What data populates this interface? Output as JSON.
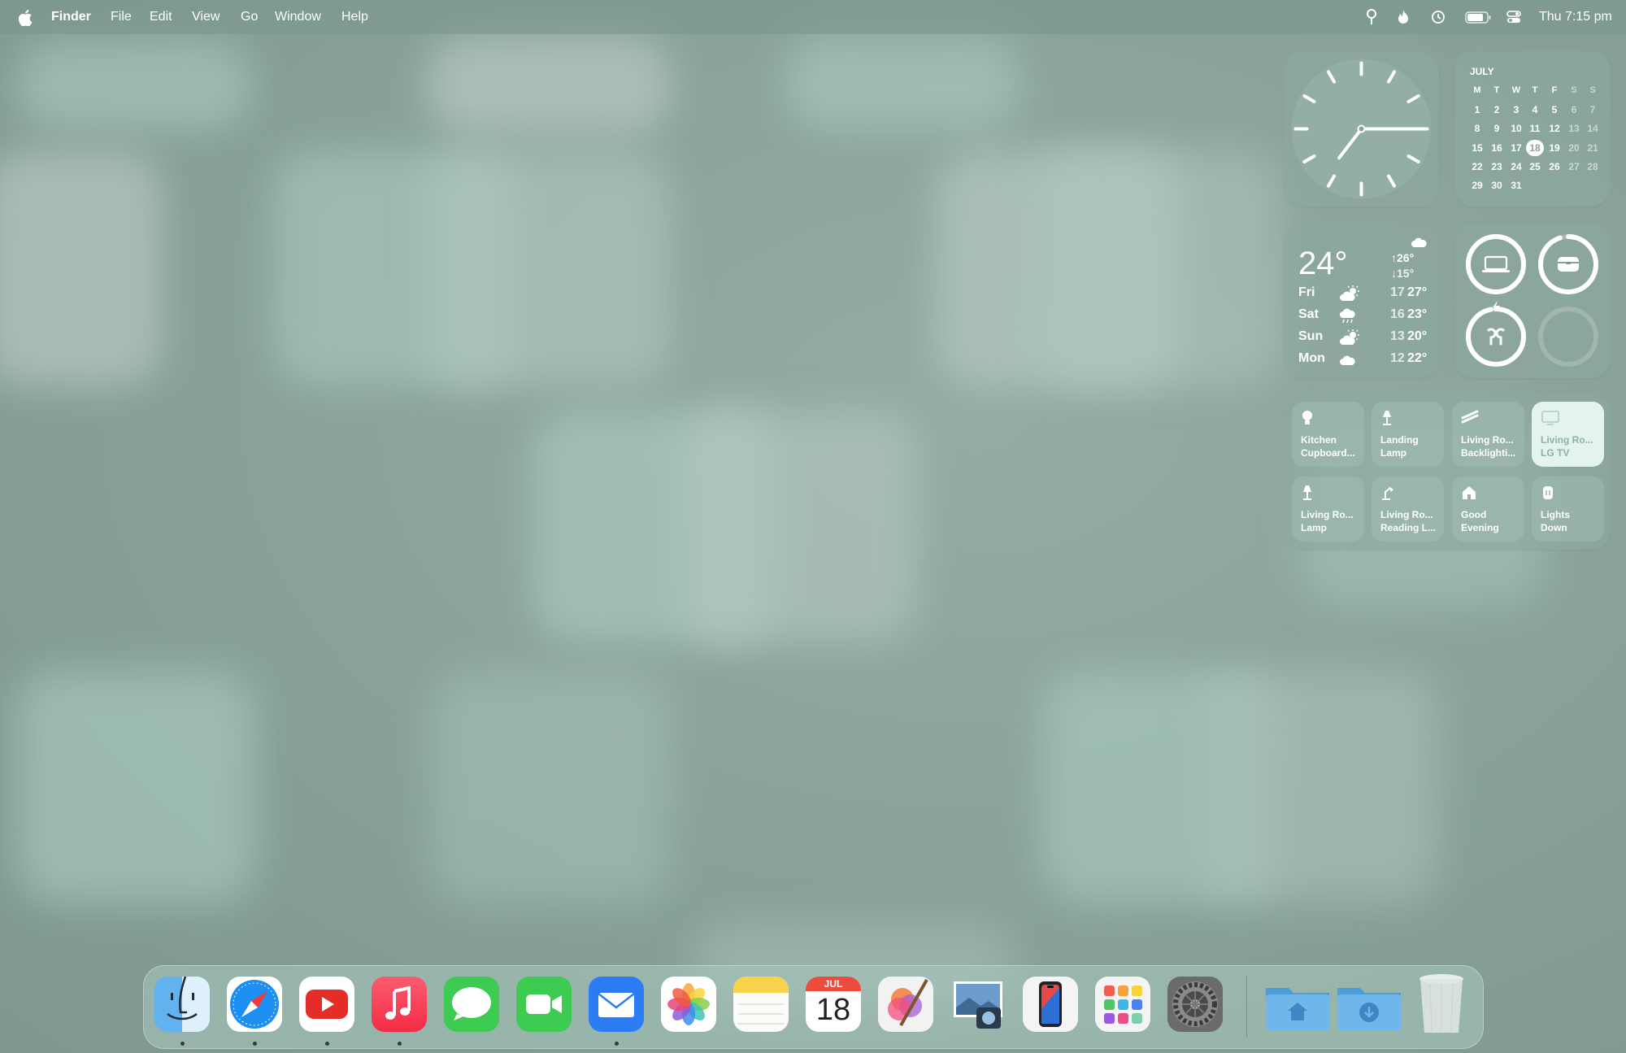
{
  "menubar": {
    "app_name": "Finder",
    "menus": [
      "File",
      "Edit",
      "View",
      "Go",
      "Window",
      "Help"
    ],
    "status_icons": [
      "location-icon",
      "flame-icon",
      "time-machine-icon",
      "battery-icon",
      "control-center-icon"
    ],
    "clock": "Thu 7:15 pm"
  },
  "clock_widget": {
    "time": "7:15",
    "hours": 7,
    "minutes": 15
  },
  "calendar": {
    "month": "JULY",
    "weekdays": [
      "M",
      "T",
      "W",
      "T",
      "F",
      "S",
      "S"
    ],
    "weeks": [
      [
        "1",
        "2",
        "3",
        "4",
        "5",
        "6",
        "7"
      ],
      [
        "8",
        "9",
        "10",
        "11",
        "12",
        "13",
        "14"
      ],
      [
        "15",
        "16",
        "17",
        "18",
        "19",
        "20",
        "21"
      ],
      [
        "22",
        "23",
        "24",
        "25",
        "26",
        "27",
        "28"
      ],
      [
        "29",
        "30",
        "31",
        "",
        "",
        "",
        ""
      ]
    ],
    "today": "18"
  },
  "weather": {
    "current": "24°",
    "high": "26°",
    "low": "15°",
    "current_icon": "cloud-icon",
    "forecast": [
      {
        "day": "Fri",
        "icon": "partly-sunny-icon",
        "low": "17",
        "high": "27°"
      },
      {
        "day": "Sat",
        "icon": "rain-icon",
        "low": "16",
        "high": "23°"
      },
      {
        "day": "Sun",
        "icon": "partly-sunny-icon",
        "low": "13",
        "high": "20°"
      },
      {
        "day": "Mon",
        "icon": "cloud-icon",
        "low": "12",
        "high": "22°"
      }
    ]
  },
  "batteries": [
    {
      "device": "laptop-icon",
      "level": 1.0
    },
    {
      "device": "case-icon",
      "level": 0.95
    },
    {
      "device": "airpods-icon",
      "level": 0.97,
      "charging": true
    },
    {
      "device": "empty",
      "level": 0
    }
  ],
  "home": {
    "tiles": [
      {
        "line1": "Kitchen",
        "line2": "Cupboard...",
        "icon": "bulb-icon",
        "on": false
      },
      {
        "line1": "Landing",
        "line2": "Lamp",
        "icon": "lamp-icon",
        "on": false
      },
      {
        "line1": "Living Ro...",
        "line2": "Backlighti...",
        "icon": "lightstrip-icon",
        "on": false
      },
      {
        "line1": "Living Ro...",
        "line2": "LG TV",
        "icon": "tv-icon",
        "on": true
      },
      {
        "line1": "Living Ro...",
        "line2": "Lamp",
        "icon": "lamp-icon",
        "on": false
      },
      {
        "line1": "Living Ro...",
        "line2": "Reading L...",
        "icon": "desk-lamp-icon",
        "on": false
      },
      {
        "line1": "Good",
        "line2": "Evening",
        "icon": "house-icon",
        "on": false
      },
      {
        "line1": "Lights",
        "line2": "Down",
        "icon": "lights-down-icon",
        "on": false
      }
    ]
  },
  "dock": {
    "apps": [
      {
        "name": "finder",
        "running": true
      },
      {
        "name": "safari",
        "running": true
      },
      {
        "name": "youtube",
        "running": true
      },
      {
        "name": "music",
        "running": true
      },
      {
        "name": "messages",
        "running": false
      },
      {
        "name": "facetime",
        "running": false
      },
      {
        "name": "mail",
        "running": true
      },
      {
        "name": "photos",
        "running": false
      },
      {
        "name": "notes",
        "running": false
      },
      {
        "name": "calendar",
        "running": false,
        "month": "JUL",
        "day": "18"
      },
      {
        "name": "pixelmator",
        "running": false
      },
      {
        "name": "preview",
        "running": false
      },
      {
        "name": "iphone-mirroring",
        "running": false
      },
      {
        "name": "launchpad",
        "running": false
      },
      {
        "name": "system-settings",
        "running": false
      }
    ],
    "folders": [
      "home-folder",
      "downloads-folder"
    ],
    "trash": "trash"
  }
}
